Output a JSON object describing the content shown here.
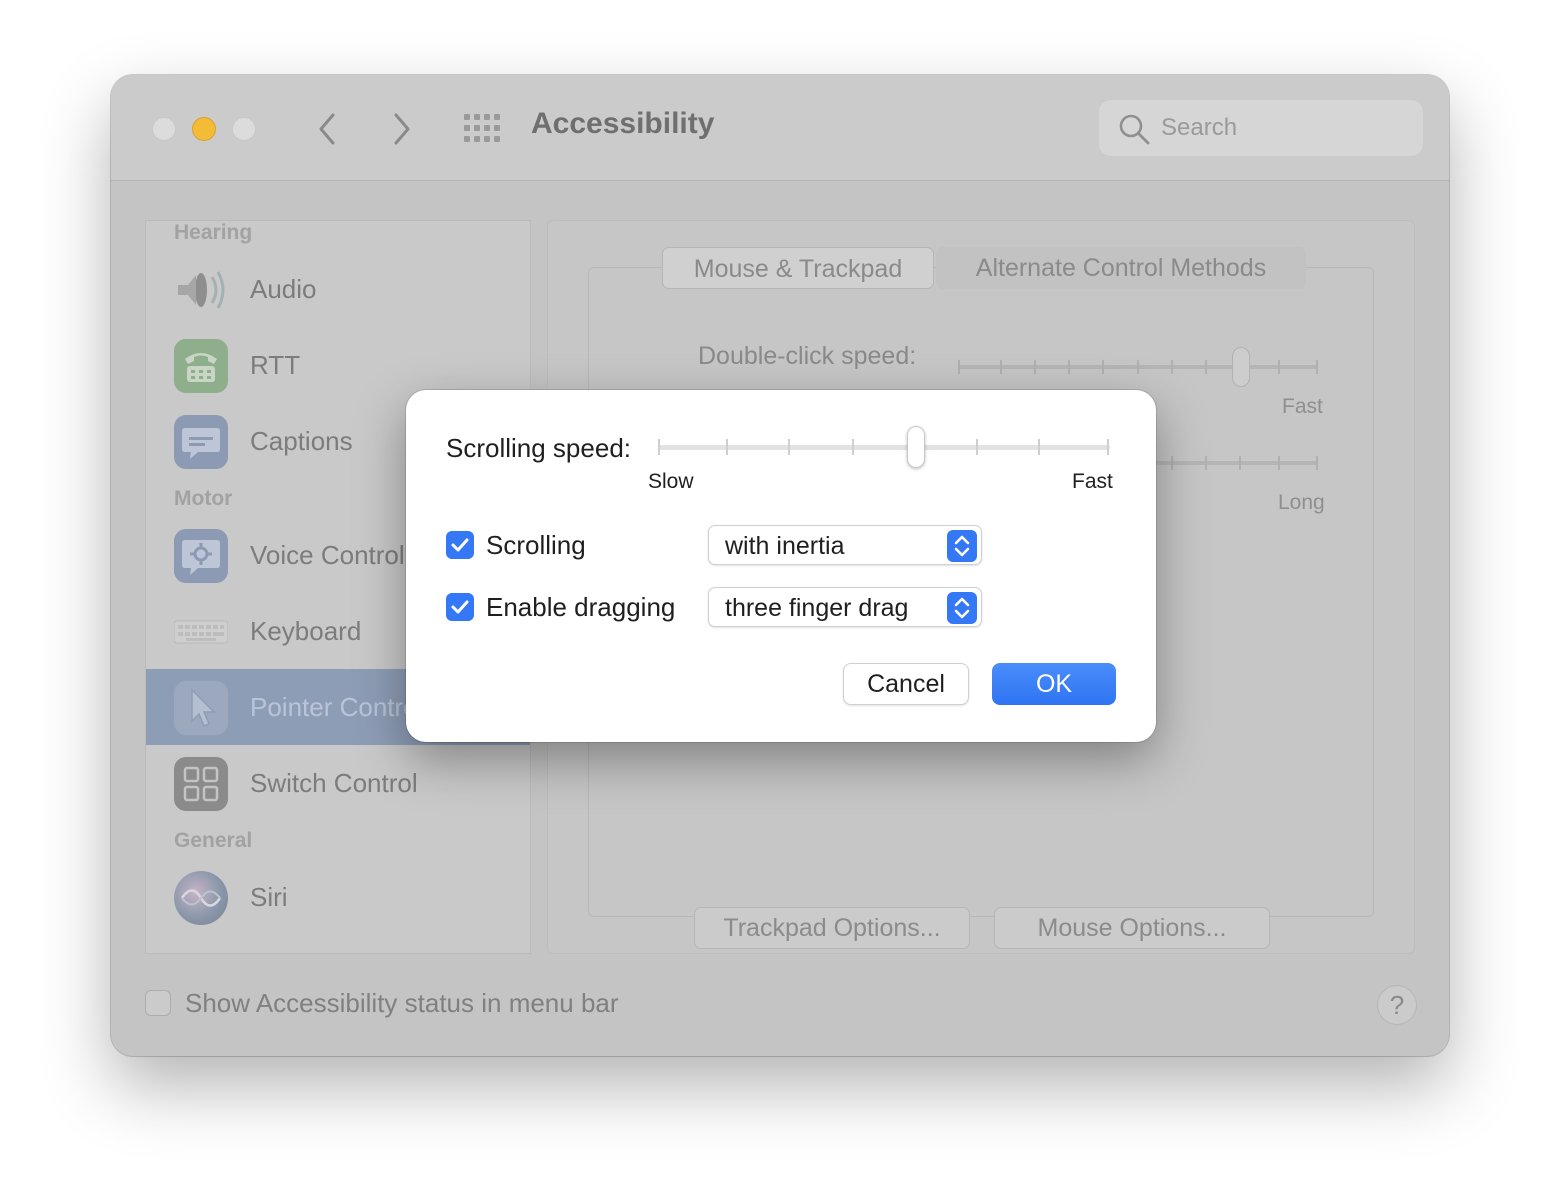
{
  "window": {
    "title": "Accessibility"
  },
  "search": {
    "placeholder": "Search"
  },
  "sidebar": {
    "sections": [
      {
        "title": "Hearing",
        "items": [
          {
            "label": "Audio",
            "icon": "speaker-icon"
          },
          {
            "label": "RTT",
            "icon": "rtt-phone-icon"
          },
          {
            "label": "Captions",
            "icon": "captions-icon"
          }
        ]
      },
      {
        "title": "Motor",
        "items": [
          {
            "label": "Voice Control",
            "icon": "voice-control-icon"
          },
          {
            "label": "Keyboard",
            "icon": "keyboard-icon"
          },
          {
            "label": "Pointer Control",
            "icon": "pointer-icon",
            "selected": true
          },
          {
            "label": "Switch Control",
            "icon": "switch-control-icon"
          }
        ]
      },
      {
        "title": "General",
        "items": [
          {
            "label": "Siri",
            "icon": "siri-icon"
          }
        ]
      }
    ]
  },
  "content": {
    "tabs": [
      "Mouse & Trackpad",
      "Alternate Control Methods"
    ],
    "double_click_label": "Double-click speed:",
    "double_click_max": "Fast",
    "spring_loading_max": "Long",
    "trackpad_options": "Trackpad Options...",
    "mouse_options": "Mouse Options..."
  },
  "footer": {
    "status_label": "Show Accessibility status in menu bar",
    "help": "?"
  },
  "sheet": {
    "scrolling_speed_label": "Scrolling speed:",
    "scrolling_speed_min": "Slow",
    "scrolling_speed_max": "Fast",
    "scrolling_speed_value": 0.57,
    "scrolling": {
      "label": "Scrolling",
      "checked": true,
      "value": "with inertia"
    },
    "dragging": {
      "label": "Enable dragging",
      "checked": true,
      "value": "three finger drag"
    },
    "cancel": "Cancel",
    "ok": "OK"
  },
  "colors": {
    "accent": "#3478f6",
    "selected_row": "#8e9db6"
  }
}
